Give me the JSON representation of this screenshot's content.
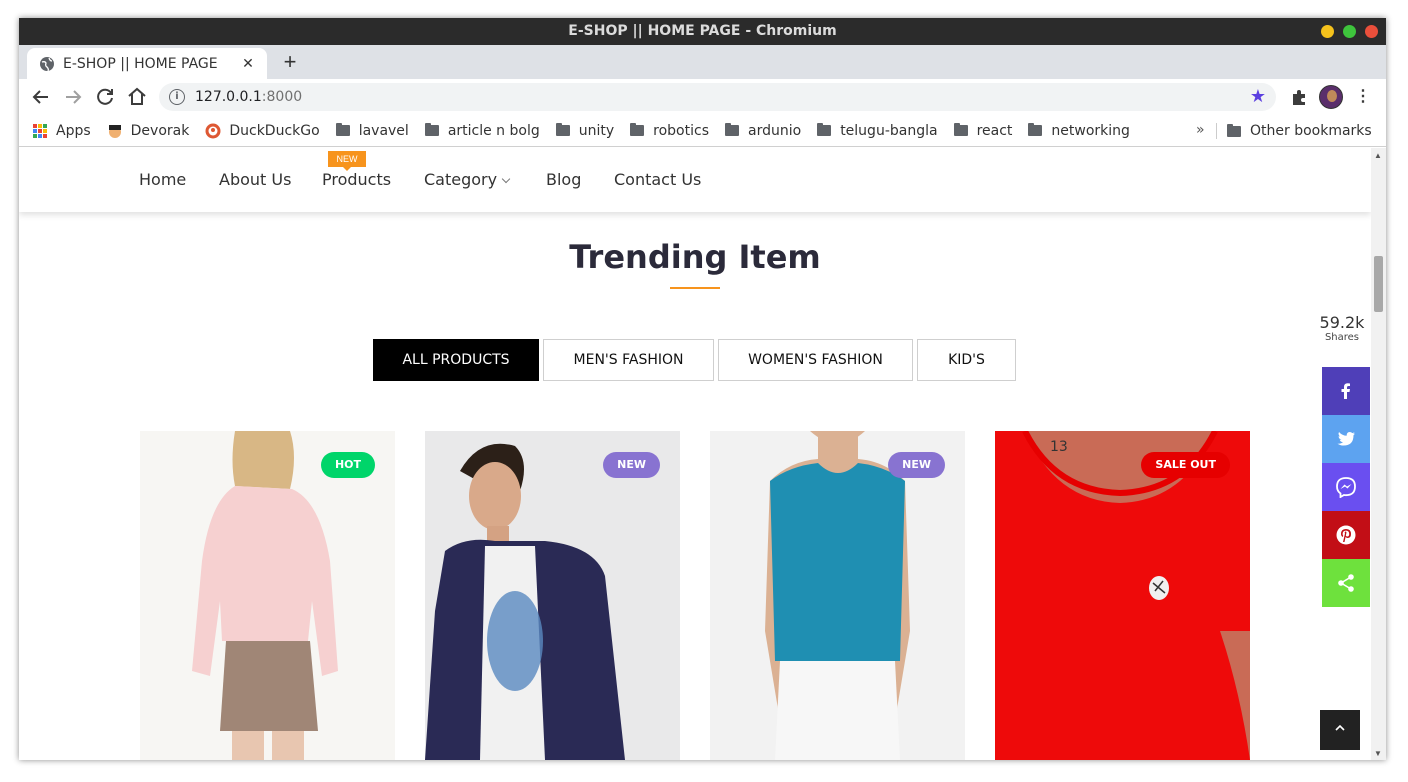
{
  "window": {
    "title": "E-SHOP || HOME PAGE - Chromium"
  },
  "tab": {
    "title": "E-SHOP || HOME PAGE",
    "close": "✕",
    "new_tab": "+"
  },
  "address": {
    "host": "127.0.0.1",
    "port": ":8000"
  },
  "bookmarks": {
    "items": [
      "Apps",
      "Devorak",
      "DuckDuckGo",
      "lavavel",
      "article n bolg",
      "unity",
      "robotics",
      "ardunio",
      "telugu-bangla",
      "react",
      "networking"
    ],
    "more": "»",
    "other": "Other bookmarks"
  },
  "nav": {
    "links": [
      "Home",
      "About Us",
      "Products",
      "Category",
      "Blog",
      "Contact Us"
    ],
    "new_badge": "NEW"
  },
  "section": {
    "title": "Trending Item"
  },
  "filters": [
    "ALL PRODUCTS",
    "MEN'S FASHION",
    "WOMEN'S FASHION",
    "KID'S"
  ],
  "products": [
    {
      "badge": "HOT",
      "badge_color": "#00d56a",
      "icon": "woman-pink-cardigan-image"
    },
    {
      "badge": "NEW",
      "badge_color": "#8873d1",
      "icon": "man-navy-blazer-image"
    },
    {
      "badge": "NEW",
      "badge_color": "#8873d1",
      "icon": "woman-teal-top-image"
    },
    {
      "badge": "SALE OUT",
      "badge_color": "#e60000",
      "icon": "red-tshirt-image"
    }
  ],
  "share": {
    "count": "59.2k",
    "label": "Shares",
    "buttons": [
      {
        "icon": "facebook-icon",
        "color": "#4f3fb8"
      },
      {
        "icon": "twitter-icon",
        "color": "#5da3f0"
      },
      {
        "icon": "messenger-icon",
        "color": "#6a4ff0"
      },
      {
        "icon": "pinterest-icon",
        "color": "#c20e16"
      },
      {
        "icon": "share-icon",
        "color": "#6ee13d"
      }
    ]
  },
  "colors": {
    "accent": "#f7941d",
    "title": "#2b2a3a"
  }
}
